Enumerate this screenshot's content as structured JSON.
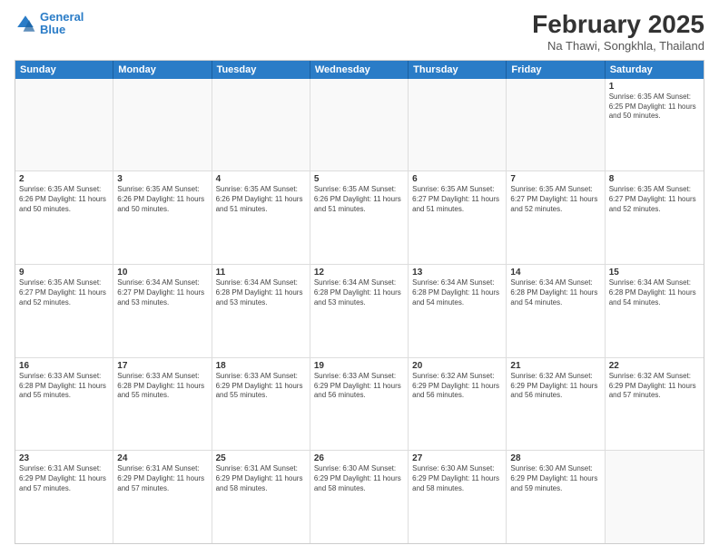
{
  "logo": {
    "line1": "General",
    "line2": "Blue"
  },
  "header": {
    "month": "February 2025",
    "location": "Na Thawi, Songkhla, Thailand"
  },
  "weekdays": [
    "Sunday",
    "Monday",
    "Tuesday",
    "Wednesday",
    "Thursday",
    "Friday",
    "Saturday"
  ],
  "weeks": [
    [
      {
        "day": "",
        "info": ""
      },
      {
        "day": "",
        "info": ""
      },
      {
        "day": "",
        "info": ""
      },
      {
        "day": "",
        "info": ""
      },
      {
        "day": "",
        "info": ""
      },
      {
        "day": "",
        "info": ""
      },
      {
        "day": "1",
        "info": "Sunrise: 6:35 AM\nSunset: 6:25 PM\nDaylight: 11 hours\nand 50 minutes."
      }
    ],
    [
      {
        "day": "2",
        "info": "Sunrise: 6:35 AM\nSunset: 6:26 PM\nDaylight: 11 hours\nand 50 minutes."
      },
      {
        "day": "3",
        "info": "Sunrise: 6:35 AM\nSunset: 6:26 PM\nDaylight: 11 hours\nand 50 minutes."
      },
      {
        "day": "4",
        "info": "Sunrise: 6:35 AM\nSunset: 6:26 PM\nDaylight: 11 hours\nand 51 minutes."
      },
      {
        "day": "5",
        "info": "Sunrise: 6:35 AM\nSunset: 6:26 PM\nDaylight: 11 hours\nand 51 minutes."
      },
      {
        "day": "6",
        "info": "Sunrise: 6:35 AM\nSunset: 6:27 PM\nDaylight: 11 hours\nand 51 minutes."
      },
      {
        "day": "7",
        "info": "Sunrise: 6:35 AM\nSunset: 6:27 PM\nDaylight: 11 hours\nand 52 minutes."
      },
      {
        "day": "8",
        "info": "Sunrise: 6:35 AM\nSunset: 6:27 PM\nDaylight: 11 hours\nand 52 minutes."
      }
    ],
    [
      {
        "day": "9",
        "info": "Sunrise: 6:35 AM\nSunset: 6:27 PM\nDaylight: 11 hours\nand 52 minutes."
      },
      {
        "day": "10",
        "info": "Sunrise: 6:34 AM\nSunset: 6:27 PM\nDaylight: 11 hours\nand 53 minutes."
      },
      {
        "day": "11",
        "info": "Sunrise: 6:34 AM\nSunset: 6:28 PM\nDaylight: 11 hours\nand 53 minutes."
      },
      {
        "day": "12",
        "info": "Sunrise: 6:34 AM\nSunset: 6:28 PM\nDaylight: 11 hours\nand 53 minutes."
      },
      {
        "day": "13",
        "info": "Sunrise: 6:34 AM\nSunset: 6:28 PM\nDaylight: 11 hours\nand 54 minutes."
      },
      {
        "day": "14",
        "info": "Sunrise: 6:34 AM\nSunset: 6:28 PM\nDaylight: 11 hours\nand 54 minutes."
      },
      {
        "day": "15",
        "info": "Sunrise: 6:34 AM\nSunset: 6:28 PM\nDaylight: 11 hours\nand 54 minutes."
      }
    ],
    [
      {
        "day": "16",
        "info": "Sunrise: 6:33 AM\nSunset: 6:28 PM\nDaylight: 11 hours\nand 55 minutes."
      },
      {
        "day": "17",
        "info": "Sunrise: 6:33 AM\nSunset: 6:28 PM\nDaylight: 11 hours\nand 55 minutes."
      },
      {
        "day": "18",
        "info": "Sunrise: 6:33 AM\nSunset: 6:29 PM\nDaylight: 11 hours\nand 55 minutes."
      },
      {
        "day": "19",
        "info": "Sunrise: 6:33 AM\nSunset: 6:29 PM\nDaylight: 11 hours\nand 56 minutes."
      },
      {
        "day": "20",
        "info": "Sunrise: 6:32 AM\nSunset: 6:29 PM\nDaylight: 11 hours\nand 56 minutes."
      },
      {
        "day": "21",
        "info": "Sunrise: 6:32 AM\nSunset: 6:29 PM\nDaylight: 11 hours\nand 56 minutes."
      },
      {
        "day": "22",
        "info": "Sunrise: 6:32 AM\nSunset: 6:29 PM\nDaylight: 11 hours\nand 57 minutes."
      }
    ],
    [
      {
        "day": "23",
        "info": "Sunrise: 6:31 AM\nSunset: 6:29 PM\nDaylight: 11 hours\nand 57 minutes."
      },
      {
        "day": "24",
        "info": "Sunrise: 6:31 AM\nSunset: 6:29 PM\nDaylight: 11 hours\nand 57 minutes."
      },
      {
        "day": "25",
        "info": "Sunrise: 6:31 AM\nSunset: 6:29 PM\nDaylight: 11 hours\nand 58 minutes."
      },
      {
        "day": "26",
        "info": "Sunrise: 6:30 AM\nSunset: 6:29 PM\nDaylight: 11 hours\nand 58 minutes."
      },
      {
        "day": "27",
        "info": "Sunrise: 6:30 AM\nSunset: 6:29 PM\nDaylight: 11 hours\nand 58 minutes."
      },
      {
        "day": "28",
        "info": "Sunrise: 6:30 AM\nSunset: 6:29 PM\nDaylight: 11 hours\nand 59 minutes."
      },
      {
        "day": "",
        "info": ""
      }
    ]
  ]
}
